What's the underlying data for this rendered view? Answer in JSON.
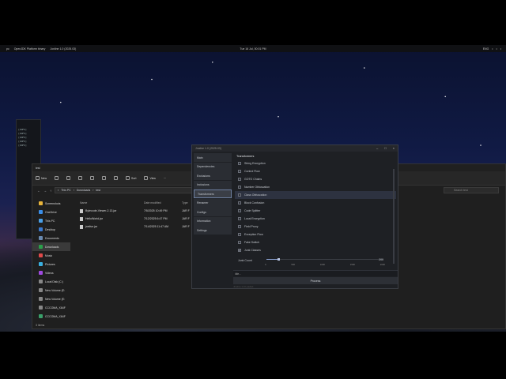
{
  "topbar": {
    "left_items": [
      "pc",
      "OpenJDK Platform binary",
      "Jonline 1.0 (2025.03)"
    ],
    "clock": "Tue 16 Jul, 00:01 PM",
    "right_items": [
      "ENG",
      "wifi",
      "vol",
      "bat"
    ]
  },
  "terminal": {
    "lines": [
      "[INFO]",
      "[INFO]",
      "[INFO]",
      "[INFO]",
      "[INFO]"
    ]
  },
  "explorer": {
    "title": "test",
    "cmd": {
      "new": "New",
      "sort": "Sort",
      "view": "View",
      "more": "···"
    },
    "breadcrumb": [
      "This PC",
      "Downloads",
      "test"
    ],
    "search_placeholder": "Search test",
    "nav": [
      {
        "label": "Screenshots",
        "color": "#e8b43a"
      },
      {
        "label": "OneDrive",
        "color": "#3a8ee8"
      },
      {
        "label": "This PC",
        "color": "#4aa0e8"
      },
      {
        "label": "Desktop",
        "color": "#3a7ad0"
      },
      {
        "label": "Documents",
        "color": "#6a8ab0"
      },
      {
        "label": "Downloads",
        "color": "#2aa04a"
      },
      {
        "label": "Music",
        "color": "#e04a4a"
      },
      {
        "label": "Pictures",
        "color": "#3ab0e0"
      },
      {
        "label": "Videos",
        "color": "#a04ae0"
      },
      {
        "label": "Local Disk (C:)",
        "color": "#888888"
      },
      {
        "label": "New Volume (E:",
        "color": "#888888"
      },
      {
        "label": "New Volume (E:",
        "color": "#888888"
      },
      {
        "label": "CCCOMA_X64F",
        "color": "#888888"
      },
      {
        "label": "CCCOMA_X64F",
        "color": "#3aa06a"
      }
    ],
    "columns": [
      "Name",
      "Date modified",
      "Type"
    ],
    "files": [
      {
        "name": "Bytecode-Viewer-2.13.jar",
        "date": "7/5/2025 10:49 PM",
        "type": "JAR F"
      },
      {
        "name": "HelloWorld.jar",
        "date": "7/12/2025 6:47 PM",
        "type": "JAR F"
      },
      {
        "name": "jnetive.jar",
        "date": "7/14/2025 11:47 AM",
        "type": "JAR F"
      }
    ],
    "status": "3 items"
  },
  "app": {
    "title": "Jnative 1.0 (2025.03)",
    "tabs": [
      "Main",
      "Dependencies",
      "Exclusions",
      "Inclusions",
      "Transformers",
      "Renamer",
      "Configs",
      "Information",
      "Settings"
    ],
    "selected_tab": "Transformers",
    "heading": "Transformers",
    "options": [
      {
        "label": "String Encryption",
        "checked": false
      },
      {
        "label": "Control Flow",
        "checked": false
      },
      {
        "label": "GOTO Chains",
        "checked": false
      },
      {
        "label": "Number Obfuscation",
        "checked": false
      },
      {
        "label": "Class Obfuscation",
        "checked": false
      },
      {
        "label": "Block Confusion",
        "checked": false
      },
      {
        "label": "Code Splitter",
        "checked": false
      },
      {
        "label": "Local Encryption",
        "checked": false
      },
      {
        "label": "Field Proxy",
        "checked": false
      },
      {
        "label": "Exception Flow",
        "checked": false
      },
      {
        "label": "Fake Switch",
        "checked": false
      },
      {
        "label": "Junk Classes",
        "checked": true
      }
    ],
    "slider": {
      "label": "Junk Count",
      "value": "200",
      "level": 0.1,
      "ticks": [
        "0",
        "500",
        "1000",
        "1500",
        "2000"
      ]
    },
    "log": "Idle...",
    "process": "Process",
    "footer": "Jnative 1.0 Loaded"
  }
}
